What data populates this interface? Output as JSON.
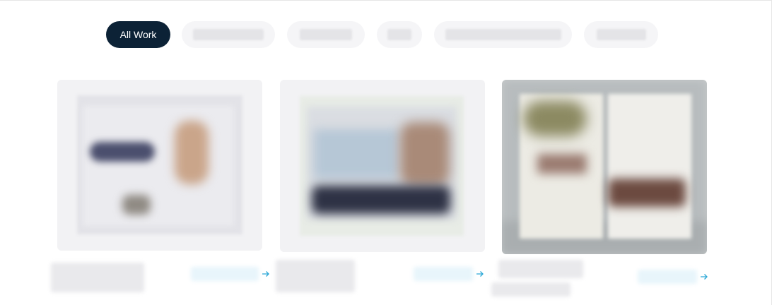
{
  "filters": {
    "items": [
      {
        "label": "All Work",
        "active": true
      }
    ]
  },
  "colors": {
    "active_chip_bg": "#0c2236",
    "chip_bg": "#f5f5f7",
    "link_accent": "#2aa7d6"
  },
  "icons": {
    "link_arrow": "arrow-right-icon"
  }
}
